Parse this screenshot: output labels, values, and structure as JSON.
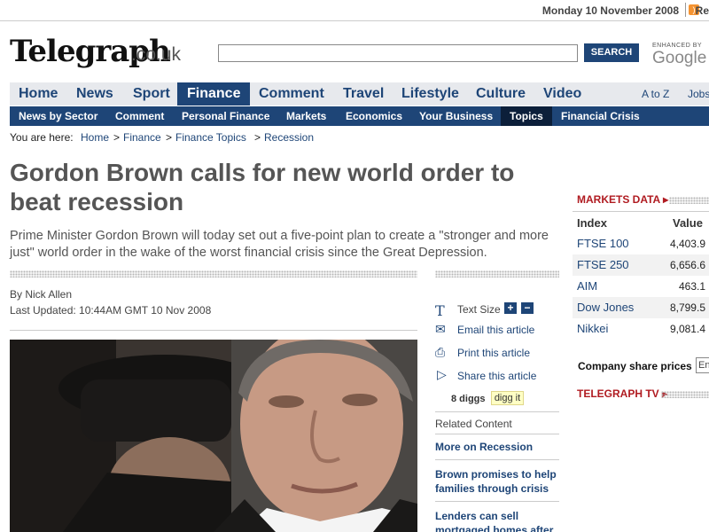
{
  "topbar": {
    "date": "Monday 10 November 2008",
    "rss_label": "Re"
  },
  "header": {
    "logo": "Telegraph",
    "logo_suffix": ".co.uk",
    "search_button": "SEARCH",
    "google_small": "ENHANCED BY",
    "google": "Google"
  },
  "nav": {
    "items": [
      "Home",
      "News",
      "Sport",
      "Finance",
      "Comment",
      "Travel",
      "Lifestyle",
      "Culture",
      "Video"
    ],
    "active": "Finance",
    "right": [
      "A to Z",
      "Jobs"
    ]
  },
  "subnav": {
    "items": [
      "News by Sector",
      "Comment",
      "Personal Finance",
      "Markets",
      "Economics",
      "Your Business",
      "Topics",
      "Financial Crisis"
    ],
    "active": "Topics"
  },
  "breadcrumb": {
    "label": "You are here:",
    "items": [
      "Home",
      "Finance",
      "Finance Topics",
      "Recession"
    ]
  },
  "article": {
    "headline": "Gordon Brown calls for new world order to beat recession",
    "standfirst": "Prime Minister Gordon Brown will today set out a five-point plan to create a \"stronger and more just\" world order in the wake of the worst financial crisis since the Great Depression.",
    "byline": "By Nick Allen",
    "updated": "Last Updated: 10:44AM GMT 10 Nov 2008"
  },
  "tools": {
    "text_size": "Text Size",
    "plus": "+",
    "minus": "−",
    "email": "Email this article",
    "print": "Print this article",
    "share": "Share this article",
    "diggs": "8 diggs",
    "digg_it": "digg it",
    "icons": [
      "text-size-icon",
      "email-icon",
      "print-icon",
      "share-icon"
    ]
  },
  "related": {
    "heading": "Related Content",
    "links": [
      "More on Recession",
      "Brown promises to help families through crisis",
      "Lenders can sell mortgaged homes after"
    ]
  },
  "markets": {
    "heading": "MARKETS DATA ▸",
    "col_index": "Index",
    "col_value": "Value",
    "rows": [
      {
        "name": "FTSE 100",
        "value": "4,403.9"
      },
      {
        "name": "FTSE 250",
        "value": "6,656.6"
      },
      {
        "name": "AIM",
        "value": "463.1"
      },
      {
        "name": "Dow Jones",
        "value": "8,799.5"
      },
      {
        "name": "Nikkei",
        "value": "9,081.4"
      }
    ],
    "company_label": "Company share prices",
    "company_input": "En"
  },
  "tv": {
    "heading": "TELEGRAPH TV ▸"
  },
  "colors": {
    "navy": "#1e4577",
    "red": "#b01b21"
  }
}
